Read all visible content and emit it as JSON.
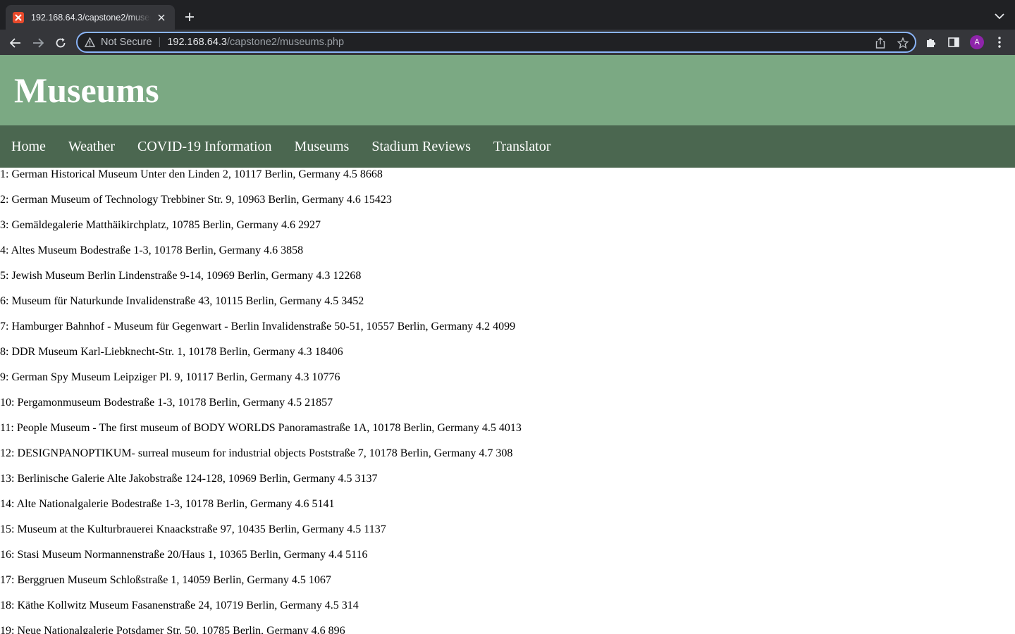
{
  "browser": {
    "tab_title": "192.168.64.3/capstone2/museums.php",
    "not_secure_label": "Not Secure",
    "url_host": "192.168.64.3",
    "url_path": "/capstone2/museums.php",
    "profile_initial": "A",
    "accent_color": "#8ab4f8",
    "profile_color": "#8e24aa"
  },
  "header": {
    "title": "Museums",
    "bg_color": "#7ba983"
  },
  "nav": {
    "bg_color": "#4b6750",
    "items": [
      {
        "label": "Home"
      },
      {
        "label": "Weather"
      },
      {
        "label": "COVID-19 Information"
      },
      {
        "label": "Museums"
      },
      {
        "label": "Stadium Reviews"
      },
      {
        "label": "Translator"
      }
    ]
  },
  "museums": [
    "1: German Historical Museum Unter den Linden 2, 10117 Berlin, Germany 4.5 8668",
    "2: German Museum of Technology Trebbiner Str. 9, 10963 Berlin, Germany 4.6 15423",
    "3: Gemäldegalerie Matthäikirchplatz, 10785 Berlin, Germany 4.6 2927",
    "4: Altes Museum Bodestraße 1-3, 10178 Berlin, Germany 4.6 3858",
    "5: Jewish Museum Berlin Lindenstraße 9-14, 10969 Berlin, Germany 4.3 12268",
    "6: Museum für Naturkunde Invalidenstraße 43, 10115 Berlin, Germany 4.5 3452",
    "7: Hamburger Bahnhof - Museum für Gegenwart - Berlin Invalidenstraße 50-51, 10557 Berlin, Germany 4.2 4099",
    "8: DDR Museum Karl-Liebknecht-Str. 1, 10178 Berlin, Germany 4.3 18406",
    "9: German Spy Museum Leipziger Pl. 9, 10117 Berlin, Germany 4.3 10776",
    "10: Pergamonmuseum Bodestraße 1-3, 10178 Berlin, Germany 4.5 21857",
    "11: People Museum - The first museum of BODY WORLDS Panoramastraße 1A, 10178 Berlin, Germany 4.5 4013",
    "12: DESIGNPANOPTIKUM- surreal museum for industrial objects Poststraße 7, 10178 Berlin, Germany 4.7 308",
    "13: Berlinische Galerie Alte Jakobstraße 124-128, 10969 Berlin, Germany 4.5 3137",
    "14: Alte Nationalgalerie Bodestraße 1-3, 10178 Berlin, Germany 4.6 5141",
    "15: Museum at the Kulturbrauerei Knaackstraße 97, 10435 Berlin, Germany 4.5 1137",
    "16: Stasi Museum Normannenstraße 20/Haus 1, 10365 Berlin, Germany 4.4 5116",
    "17: Berggruen Museum Schloßstraße 1, 14059 Berlin, Germany 4.5 1067",
    "18: Käthe Kollwitz Museum Fasanenstraße 24, 10719 Berlin, Germany 4.5 314",
    "19: Neue Nationalgalerie Potsdamer Str. 50, 10785 Berlin, Germany 4.6 896"
  ]
}
